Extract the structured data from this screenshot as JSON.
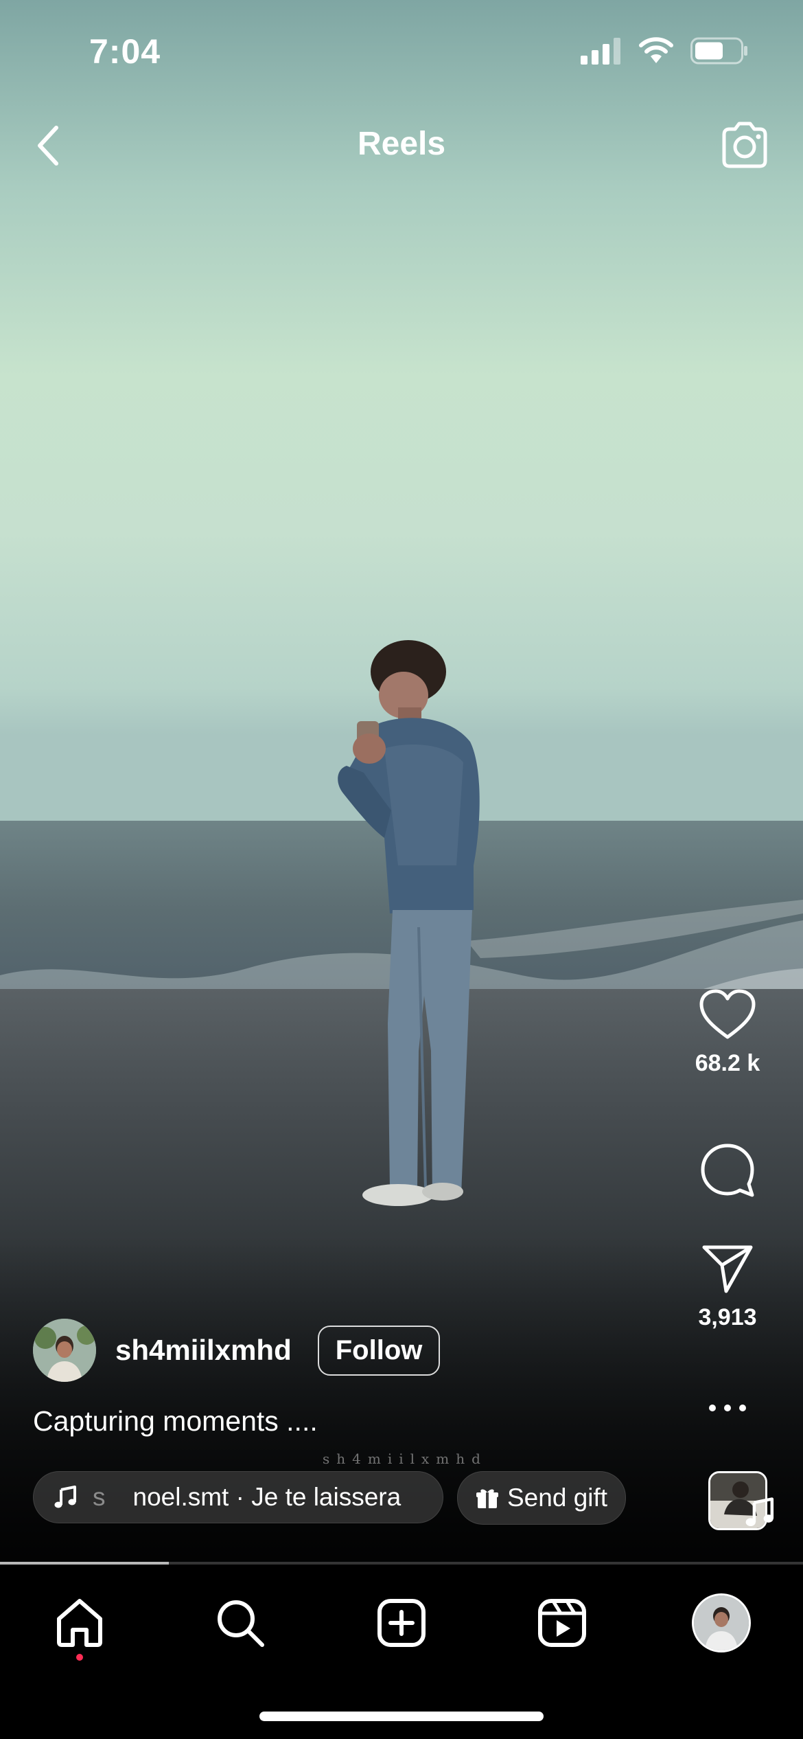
{
  "status_bar": {
    "time": "7:04"
  },
  "header": {
    "title": "Reels",
    "back_icon": "chevron-left-icon",
    "camera_icon": "camera-icon"
  },
  "actions": {
    "likes": "68.2 k",
    "shares": "3,913",
    "like_icon": "heart-icon",
    "comment_icon": "comment-bubble-icon",
    "share_icon": "paper-plane-icon",
    "more_icon": "more-horizontal-icon"
  },
  "post": {
    "username": "sh4miilxmhd",
    "follow_label": "Follow",
    "caption": "Capturing moments ....",
    "watermark": "sh4miilxmhd",
    "music_prefix": "s",
    "music_text": "noel.smt · Je te laissera",
    "gift_label": "Send gift"
  },
  "playback": {
    "progress": 0.21
  },
  "tabbar": {
    "items": [
      "home",
      "search",
      "create",
      "reels",
      "profile"
    ],
    "active": "home"
  },
  "colors": {
    "accent_dot": "#ff2d55",
    "background": "#000000"
  }
}
